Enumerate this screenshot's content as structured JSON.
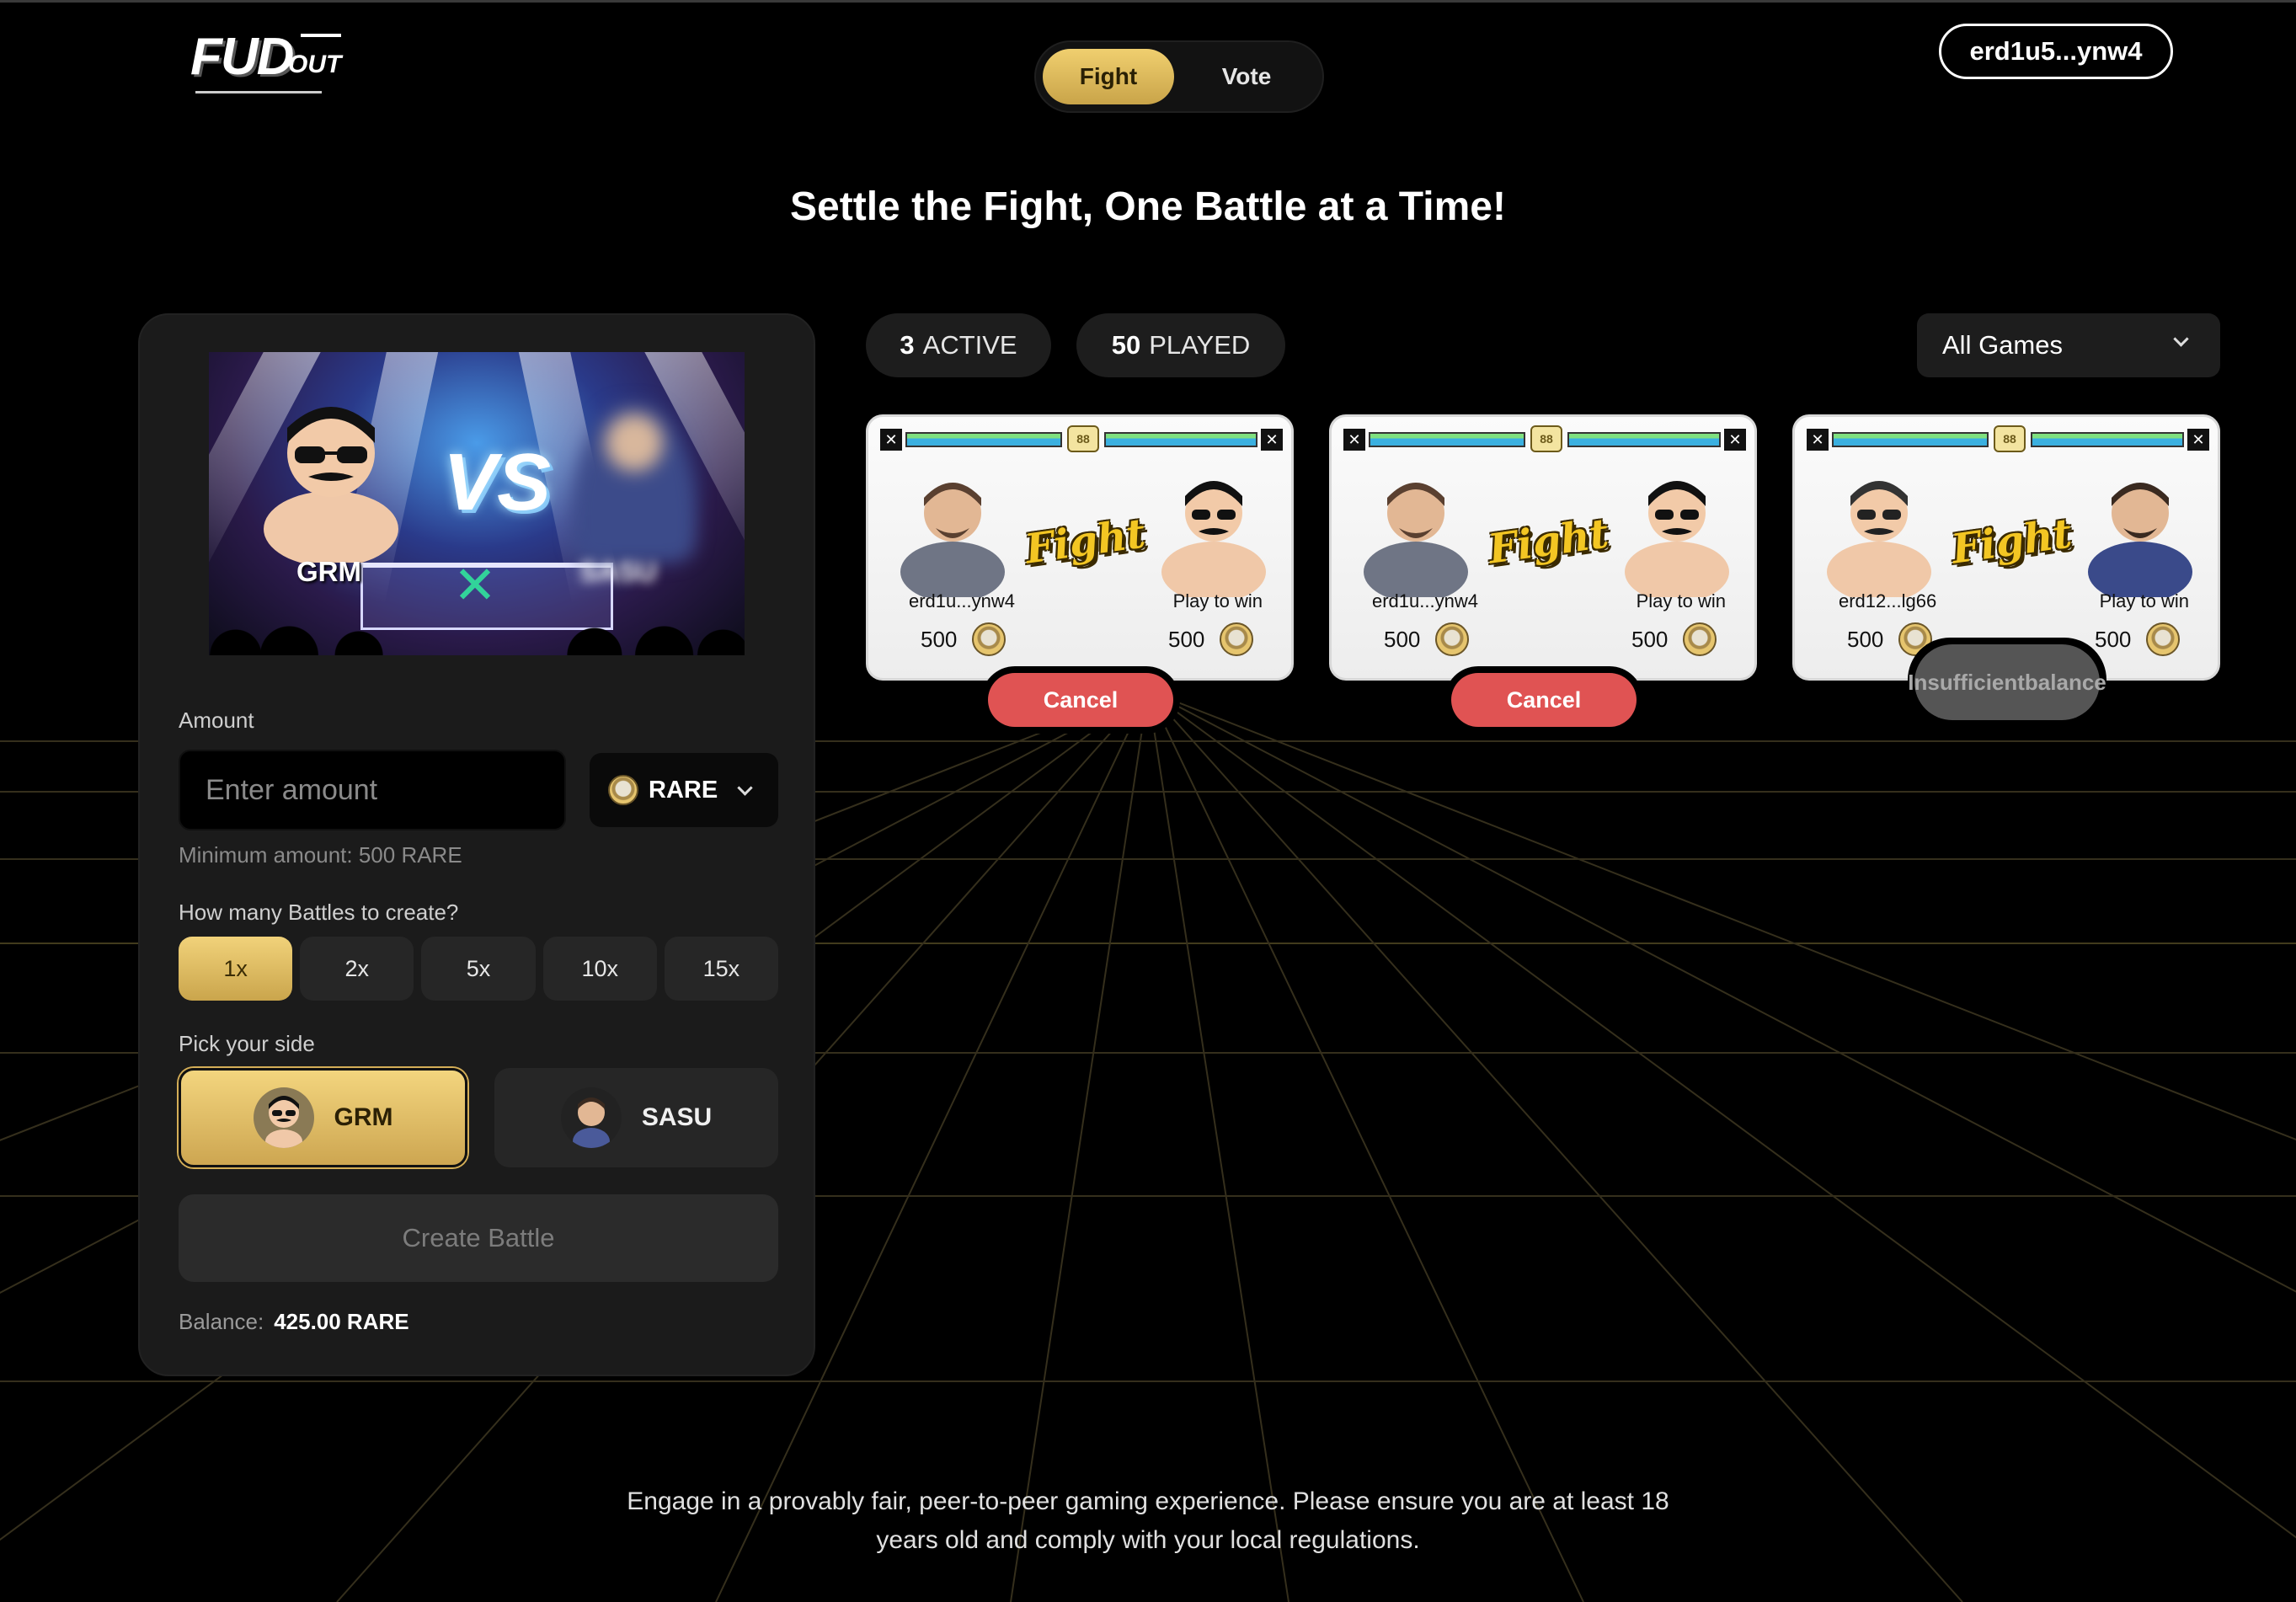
{
  "header": {
    "logo_main": "FUD",
    "logo_sub": "OUT",
    "nav": [
      {
        "label": "Fight",
        "active": true
      },
      {
        "label": "Vote",
        "active": false
      }
    ],
    "wallet": "erd1u5...ynw4"
  },
  "hero": {
    "title": "Settle the Fight, One Battle at a Time!"
  },
  "create_panel": {
    "preview": {
      "left_name": "GRM",
      "right_name": "SASU",
      "vs": "VS"
    },
    "amount_label": "Amount",
    "amount_placeholder": "Enter amount",
    "token": "RARE",
    "min_note": "Minimum amount: 500 RARE",
    "battles_label": "How many Battles to create?",
    "multipliers": [
      "1x",
      "2x",
      "5x",
      "10x",
      "15x"
    ],
    "selected_multiplier": "1x",
    "side_label": "Pick your side",
    "sides": [
      {
        "name": "GRM",
        "selected": true
      },
      {
        "name": "SASU",
        "selected": false
      }
    ],
    "create_button": "Create Battle",
    "balance_label": "Balance:",
    "balance_value": "425.00 RARE"
  },
  "stats": {
    "active_count": "3",
    "active_label": "ACTIVE",
    "played_count": "50",
    "played_label": "PLAYED"
  },
  "filter": {
    "selected": "All Games"
  },
  "battles": [
    {
      "player": "erd1u...ynw4",
      "player_amount": "500",
      "opponent_label": "Play to win",
      "opponent_amount": "500",
      "fight_word": "Fight",
      "timer": "88",
      "action": "Cancel",
      "action_type": "cancel"
    },
    {
      "player": "erd1u...ynw4",
      "player_amount": "500",
      "opponent_label": "Play to win",
      "opponent_amount": "500",
      "fight_word": "Fight",
      "timer": "88",
      "action": "Cancel",
      "action_type": "cancel"
    },
    {
      "player": "erd12...lg66",
      "player_amount": "500",
      "opponent_label": "Play to win",
      "opponent_amount": "500",
      "fight_word": "Fight",
      "timer": "88",
      "action_line1": "Insufficient",
      "action_line2": "balance",
      "action_type": "disabled"
    }
  ],
  "footer": {
    "line1": "Engage in a provably fair, peer-to-peer gaming experience. Please ensure you are at least 18",
    "line2": "years old and comply with your local regulations."
  },
  "colors": {
    "gold": "#d9b458",
    "cancel_red": "#e05353",
    "background": "#000000",
    "panel": "#1b1b1b"
  }
}
